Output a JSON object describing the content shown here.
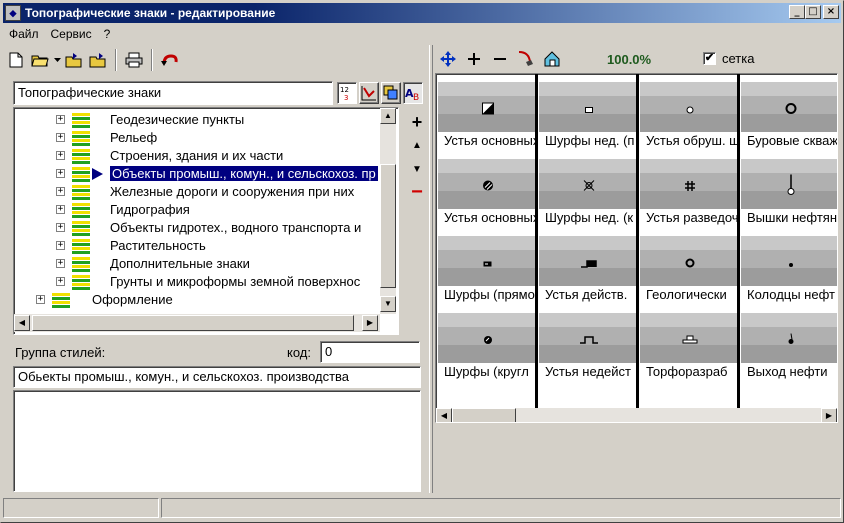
{
  "window": {
    "title": "Топографические знаки - редактирование",
    "minimize": "_",
    "maximize": "□",
    "close": "×"
  },
  "menu": [
    "Файл",
    "Сервис",
    "?"
  ],
  "toolbar": {
    "icons": [
      "new-file-icon",
      "open-folder-icon",
      "open-dropdown-icon",
      "folder-add-icon",
      "folder-export-icon",
      "print-icon",
      "undo-icon"
    ]
  },
  "left": {
    "tree_title": "Топографические знаки",
    "header_icons": [
      "sort-numeric-icon",
      "line-style-icon",
      "area-style-icon",
      "text-style-icon"
    ],
    "tree_items": [
      {
        "label": "Геодезические пункты",
        "level": 1,
        "expander": "+"
      },
      {
        "label": "Рельеф",
        "level": 1,
        "expander": "+"
      },
      {
        "label": "Строения, здания и их части",
        "level": 1,
        "expander": "+"
      },
      {
        "label": "Объекты промыш., комун., и сельскохоз. пр",
        "level": 1,
        "expander": "+",
        "selected": true
      },
      {
        "label": "Железные дороги и сооружения при них",
        "level": 1,
        "expander": "+"
      },
      {
        "label": "Гидрография",
        "level": 1,
        "expander": "+"
      },
      {
        "label": "Объекты гидротех., водного транспорта и",
        "level": 1,
        "expander": "+"
      },
      {
        "label": "Растительность",
        "level": 1,
        "expander": "+"
      },
      {
        "label": "Дополнительные знаки",
        "level": 1,
        "expander": "+"
      },
      {
        "label": "Грунты и микроформы земной поверхнос",
        "level": 1,
        "expander": "+"
      },
      {
        "label": "Оформление",
        "level": 0,
        "expander": "+"
      }
    ],
    "side_buttons": [
      "+",
      "▲",
      "▼",
      "−"
    ],
    "style_group_label": "Группа стилей:",
    "code_label": "код:",
    "code_value": "0",
    "group_name": "Обьекты промыш., комун., и сельскохоз. производства",
    "description": ""
  },
  "right": {
    "tool_icons": [
      "move-icon",
      "zoom-in-icon",
      "zoom-out-icon",
      "pen-draw-icon",
      "home-view-icon"
    ],
    "zoom": "100.0%",
    "grid_checked": "✔",
    "grid_label": "сетка",
    "cells": [
      {
        "caption": "Устья основных",
        "symbol": "square-half"
      },
      {
        "caption": "Шурфы нед. (п",
        "symbol": "small-square"
      },
      {
        "caption": "Устья обруш. ш",
        "symbol": "small-circle"
      },
      {
        "caption": "Буровые скважи",
        "symbol": "big-circle"
      },
      {
        "caption": "Устья основных",
        "symbol": "hatched-circle"
      },
      {
        "caption": "Шурфы нед. (к",
        "symbol": "cross-circle"
      },
      {
        "caption": "Устья разведоч",
        "symbol": "hash-square"
      },
      {
        "caption": "Вышки нефтяны",
        "symbol": "tower"
      },
      {
        "caption": "Шурфы (прямо",
        "symbol": "rect-filled"
      },
      {
        "caption": "Устья действ.",
        "symbol": "step-filled"
      },
      {
        "caption": "Геологически",
        "symbol": "ring"
      },
      {
        "caption": "Колодцы нефт",
        "symbol": "dot"
      },
      {
        "caption": "Шурфы (кругл",
        "symbol": "hatched-dot"
      },
      {
        "caption": "Устья недейст",
        "symbol": "step-open"
      },
      {
        "caption": "Торфоразраб",
        "symbol": "peat"
      },
      {
        "caption": "Выход нефти",
        "symbol": "drop"
      }
    ]
  },
  "status": [
    "",
    ""
  ]
}
